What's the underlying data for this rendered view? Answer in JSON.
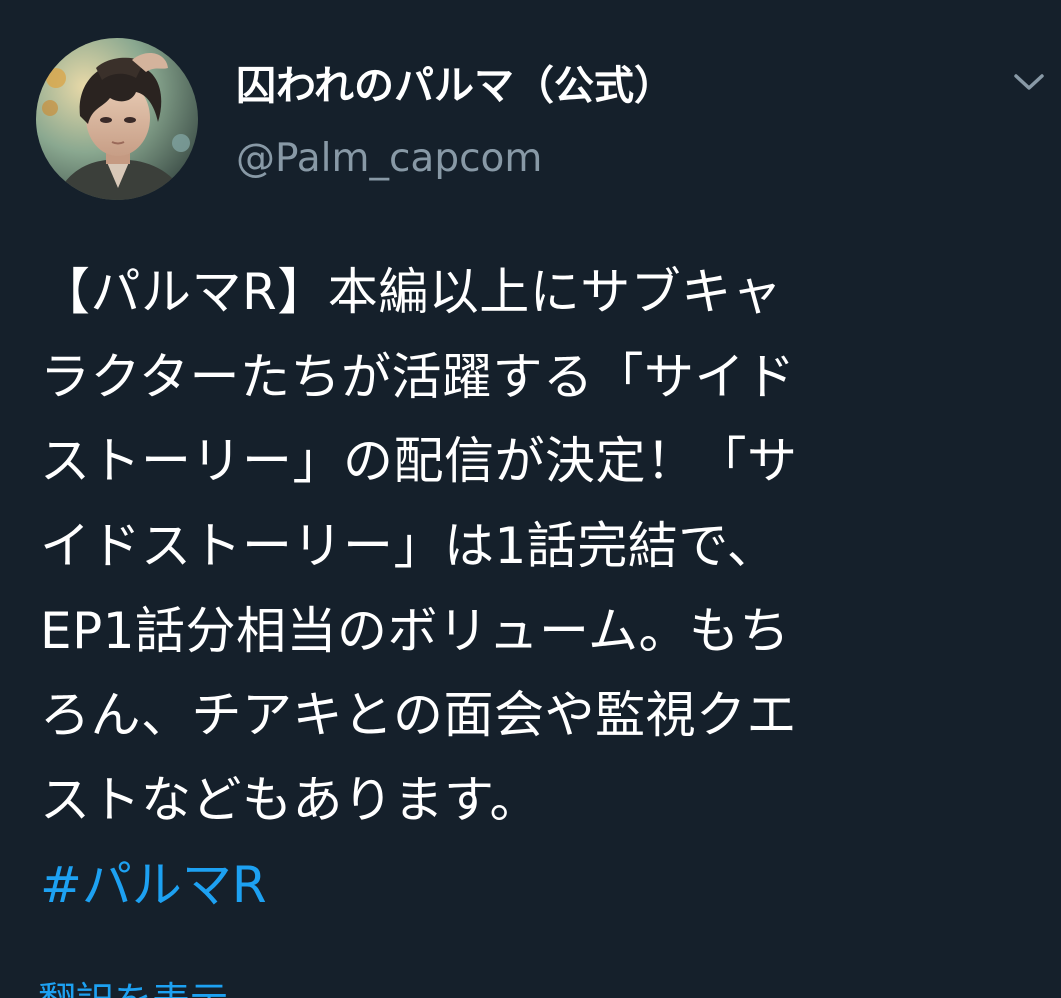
{
  "user": {
    "display_name": "囚われのパルマ（公式）",
    "handle": "@Palm_capcom"
  },
  "tweet": {
    "lines": [
      "【パルマR】本編以上にサブキャ",
      "ラクターたちが活躍する「サイド",
      "ストーリー」の配信が決定！「サ",
      "イドストーリー」は1話完結で、",
      "EP1話分相当のボリューム。もち",
      "ろん、チアキとの面会や監視クエ",
      "ストなどもあります。"
    ],
    "hashtag": "#パルマR"
  },
  "translate_label": "翻訳を表示",
  "icons": {
    "menu": "chevron-down-icon",
    "avatar": "avatar-image"
  },
  "colors": {
    "background": "#15202b",
    "text": "#ffffff",
    "secondary_text": "#8899a6",
    "accent": "#1da1f2"
  }
}
